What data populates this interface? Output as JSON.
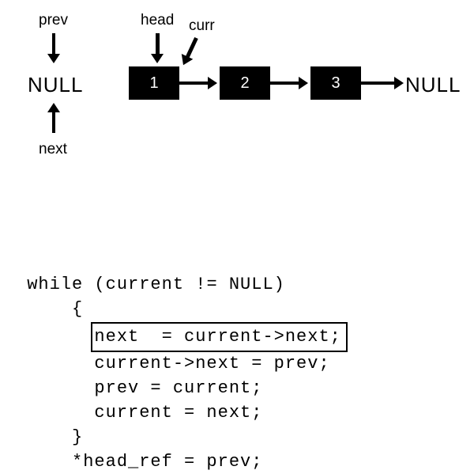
{
  "diagram": {
    "prev_label": "prev",
    "next_label": "next",
    "head_label": "head",
    "curr_label": "curr",
    "null_left": "NULL",
    "null_right": "NULL",
    "node1": "1",
    "node2": "2",
    "node3": "3"
  },
  "code": {
    "line1": "while (current != NULL)",
    "line2": "     {",
    "line3": "next  = current->next;",
    "line4": "       current->next = prev;",
    "line5": "       prev = current;",
    "line6": "       current = next;",
    "line7": "     }",
    "line8": "     *head_ref = prev;"
  }
}
